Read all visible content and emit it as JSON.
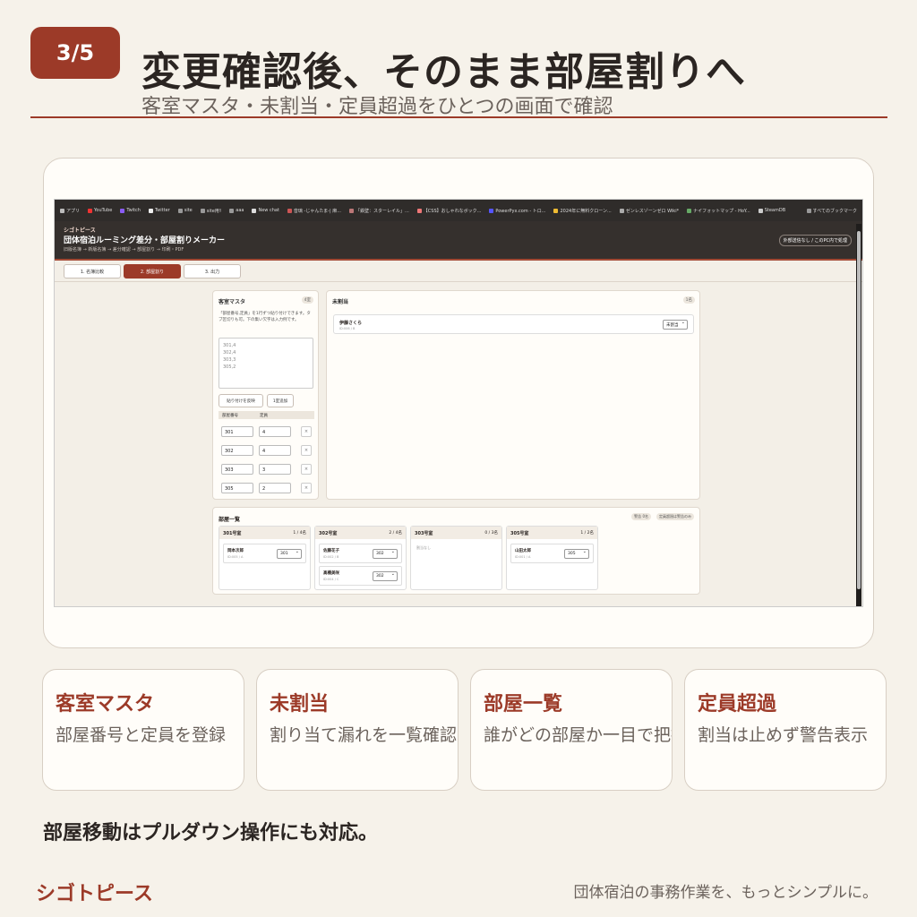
{
  "header": {
    "badge": "3/5",
    "title": "変更確認後、そのまま部屋割りへ",
    "subtitle": "客室マスタ・未割当・定員超過をひとつの画面で確認"
  },
  "browser": {
    "bookmarks": [
      {
        "label": "アプリ",
        "icon": "apps-icon"
      },
      {
        "label": "YouTube",
        "icon": "youtube-icon"
      },
      {
        "label": "Twitch",
        "icon": "twitch-icon"
      },
      {
        "label": "Twitter",
        "icon": "x-icon"
      },
      {
        "label": "site",
        "icon": "folder-icon"
      },
      {
        "label": "site用ﾘ",
        "icon": "folder-icon"
      },
      {
        "label": "aaa",
        "icon": "folder-icon"
      },
      {
        "label": "New chat",
        "icon": "chat-icon"
      },
      {
        "label": "音璃 -じゃんたま-| 麻...",
        "icon": "site-icon"
      },
      {
        "label": "「鉄壁：スターレイル」...",
        "icon": "site-icon"
      },
      {
        "label": "【CSS】おしゃれなボック...",
        "icon": "site-icon"
      },
      {
        "label": "PowerPyx.com - トロ...",
        "icon": "site-icon"
      },
      {
        "label": "2024年に無料クローン...",
        "icon": "site-icon"
      },
      {
        "label": "ゼンレスゾーンゼロ Wiki*",
        "icon": "site-icon"
      },
      {
        "label": "ナイフォットマップ - HoY...",
        "icon": "site-icon"
      },
      {
        "label": "SteamDB",
        "icon": "steam-icon"
      }
    ],
    "all_bookmarks": "すべてのブックマーク"
  },
  "app": {
    "brand": "シゴトピース",
    "title": "団体宿泊ルーミング差分・部屋割りメーカー",
    "flow": "旧版名簿 → 新版名簿 → 差分確認 → 部屋割り → 印刷・PDF",
    "external_note": "外部送信なし / このPC内で処理",
    "tabs": [
      "1. 名簿比較",
      "2. 部屋割り",
      "3. 出力"
    ]
  },
  "master": {
    "title": "客室マスタ",
    "count": "4室",
    "description": "「部屋番号,定員」を1行ずつ貼り付けできます。タブ区切りも可。下の集い欠字は入力例です。",
    "textarea_lines": [
      "301,4",
      "302,4",
      "303,3",
      "305,2"
    ],
    "apply_button": "貼り付けを反映",
    "add_button": "1室追加",
    "col_room": "部屋番号",
    "col_capacity": "定員",
    "rows": [
      {
        "room": "301",
        "cap": "4"
      },
      {
        "room": "302",
        "cap": "4"
      },
      {
        "room": "303",
        "cap": "3"
      },
      {
        "room": "305",
        "cap": "2"
      }
    ],
    "remove_label": "×"
  },
  "unassigned": {
    "title": "未割当",
    "count": "1名",
    "item": {
      "name": "伊藤さくら",
      "id": "ID:006 / B",
      "select": "未割当"
    }
  },
  "rooms": {
    "title": "部屋一覧",
    "chip_over": "警告 0名",
    "chip_note": "定員超過は警告のみ",
    "list": [
      {
        "name": "301号室",
        "count": "1 / 4名",
        "guests": [
          {
            "name": "岡本次郎",
            "id": "ID:005 / A",
            "sel": "301"
          }
        ]
      },
      {
        "name": "302号室",
        "count": "2 / 4名",
        "guests": [
          {
            "name": "佐藤花子",
            "id": "ID:002 / B",
            "sel": "302"
          },
          {
            "name": "高橋美咲",
            "id": "ID:004 / C",
            "sel": "302"
          }
        ]
      },
      {
        "name": "303号室",
        "count": "0 / 3名",
        "empty": "割当なし",
        "guests": []
      },
      {
        "name": "305号室",
        "count": "1 / 2名",
        "guests": [
          {
            "name": "山田太郎",
            "id": "ID:001 / A",
            "sel": "305"
          }
        ]
      }
    ]
  },
  "features": [
    {
      "title": "客室マスタ",
      "desc": "部屋番号と定員を登録"
    },
    {
      "title": "未割当",
      "desc": "割り当て漏れを一覧確認"
    },
    {
      "title": "部屋一覧",
      "desc": "誰がどの部屋か一目で把握"
    },
    {
      "title": "定員超過",
      "desc": "割当は止めず警告表示"
    }
  ],
  "note": "部屋移動はプルダウン操作にも対応。",
  "footer": {
    "brand": "シゴトピース",
    "tagline": "団体宿泊の事務作業を、もっとシンプルに。"
  }
}
